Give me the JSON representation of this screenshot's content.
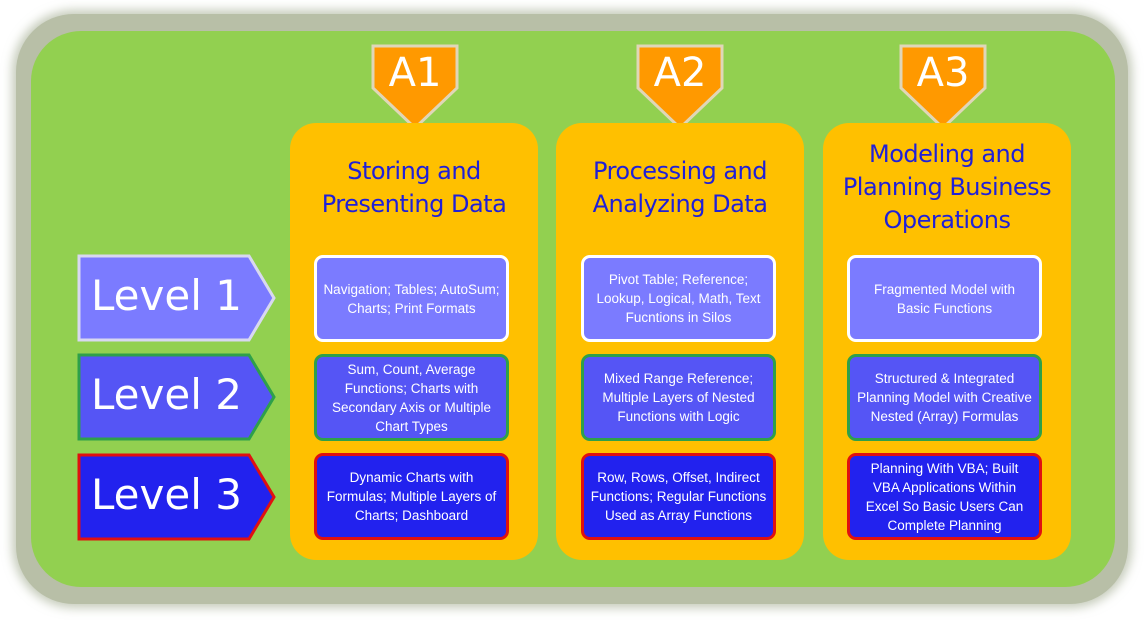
{
  "colors": {
    "background_green": "#92d050",
    "column_gold": "#ffc000",
    "badge_orange": "#ff9900",
    "title_blue": "#2020d8",
    "level1_fill": "#7b7bff",
    "level2_fill": "#5555f5",
    "level3_fill": "#2222ee",
    "level1_border": "#ffffff",
    "level2_border": "#2ea04a",
    "level3_border": "#e01010"
  },
  "levels": [
    {
      "label": "Level 1"
    },
    {
      "label": "Level 2"
    },
    {
      "label": "Level 3"
    }
  ],
  "columns": [
    {
      "badge": "A1",
      "title_lines": [
        "Storing and",
        "Presenting Data"
      ],
      "cells": [
        "Navigation; Tables; AutoSum; Charts; Print Formats",
        "Sum, Count, Average Functions; Charts with Secondary Axis or Multiple Chart Types",
        "Dynamic Charts with Formulas; Multiple Layers of Charts; Dashboard"
      ]
    },
    {
      "badge": "A2",
      "title_lines": [
        "Processing and",
        "Analyzing Data"
      ],
      "cells": [
        "Pivot Table; Reference; Lookup, Logical, Math, Text Fucntions in Silos",
        "Mixed Range Reference; Multiple Layers of Nested Functions with Logic",
        "Row, Rows, Offset, Indirect Functions; Regular Functions  Used as Array Functions"
      ]
    },
    {
      "badge": "A3",
      "title_lines": [
        "Modeling and",
        "Planning Business",
        "Operations"
      ],
      "cells": [
        "Fragmented Model with Basic Functions",
        "Structured & Integrated Planning Model  with Creative Nested (Array) Formulas",
        "Planning With VBA; Built VBA Applications  Within Excel  So Basic Users Can Complete Planning"
      ]
    }
  ]
}
